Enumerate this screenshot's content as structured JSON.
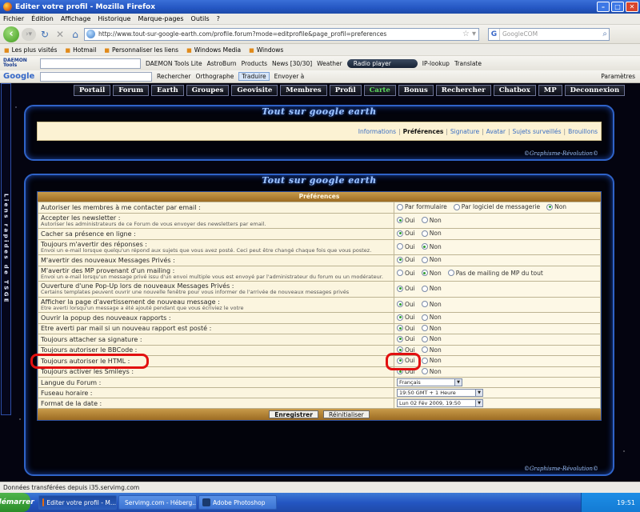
{
  "window": {
    "title": "Editer votre profil - Mozilla Firefox"
  },
  "menu": [
    "Fichier",
    "Édition",
    "Affichage",
    "Historique",
    "Marque-pages",
    "Outils",
    "?"
  ],
  "nav": {
    "url": "http://www.tout-sur-google-earth.com/profile.forum?mode=editprofile&page_profil=preferences",
    "search_placeholder": "GoogleCOM"
  },
  "bookmarks": [
    "Les plus visités",
    "Hotmail",
    "Personnaliser les liens",
    "Windows Media",
    "Windows"
  ],
  "daemon_toolbar": {
    "logo": "DAEMON Tools",
    "items": [
      "DAEMON Tools Lite",
      "AstroBurn",
      "Products",
      "News [30/30]",
      "Weather"
    ],
    "radio": "Radio player",
    "extras": [
      "IP-lookup",
      "Translate"
    ]
  },
  "google_toolbar": {
    "logo": "Google",
    "items": [
      "Rechercher",
      "Orthographe",
      "Traduire",
      "Envoyer à"
    ],
    "params": "Paramètres"
  },
  "forum_nav": [
    "Portail",
    "Forum",
    "Earth",
    "Groupes",
    "Geovisite",
    "Membres",
    "Profil",
    "Carte",
    "Bonus",
    "Rechercher",
    "Chatbox",
    "MP",
    "Deconnexion"
  ],
  "active_nav": "Carte",
  "quick_links": "Liens rapides de TSGE",
  "site_title": "Tout sur google earth",
  "credit": "©Graphisme-Révolution©",
  "profile_tabs": [
    "Informations",
    "Préférences",
    "Signature",
    "Avatar",
    "Sujets surveillés",
    "Brouillons"
  ],
  "prefs": {
    "header": "Préférences",
    "rows": [
      {
        "label": "Autoriser les membres à me contacter par email :",
        "desc": "",
        "options": [
          "Par formulaire",
          "Par logiciel de messagerie",
          "Non"
        ],
        "selected": 2
      },
      {
        "label": "Accepter les newsletter :",
        "desc": "Autoriser les administrateurs de ce Forum de vous envoyer des newsletters par email.",
        "options": [
          "Oui",
          "Non"
        ],
        "selected": 0
      },
      {
        "label": "Cacher sa présence en ligne :",
        "desc": "",
        "options": [
          "Oui",
          "Non"
        ],
        "selected": 0
      },
      {
        "label": "Toujours m'avertir des réponses :",
        "desc": "Envoi un e-mail lorsque quelqu'un répond aux sujets que vous avez posté. Ceci peut être changé chaque fois que vous postez.",
        "options": [
          "Oui",
          "Non"
        ],
        "selected": 1
      },
      {
        "label": "M'avertir des nouveaux Messages Privés :",
        "desc": "",
        "options": [
          "Oui",
          "Non"
        ],
        "selected": 0
      },
      {
        "label": "M'avertir des MP provenant d'un mailing :",
        "desc": "Envoi un e-mail lorsqu'un message privé issu d'un envoi multiple vous est envoyé par l'administrateur du forum ou un modérateur.",
        "options": [
          "Oui",
          "Non",
          "Pas de mailing de MP du tout"
        ],
        "selected": 1
      },
      {
        "label": "Ouverture d'une Pop-Up lors de nouveaux Messages Privés :",
        "desc": "Certains templates peuvent ouvrir une nouvelle fenêtre pour vous informer de l'arrivée de nouveaux messages privés",
        "options": [
          "Oui",
          "Non"
        ],
        "selected": 0
      },
      {
        "label": "Afficher la page d'avertissement de nouveau message :",
        "desc": "Etre averti lorsqu'un message a été ajouté pendant que vous écriviez le votre",
        "options": [
          "Oui",
          "Non"
        ],
        "selected": 0
      },
      {
        "label": "Ouvrir la popup des nouveaux rapports :",
        "desc": "",
        "options": [
          "Oui",
          "Non"
        ],
        "selected": 0
      },
      {
        "label": "Etre averti par mail si un nouveau rapport est posté :",
        "desc": "",
        "options": [
          "Oui",
          "Non"
        ],
        "selected": 0
      },
      {
        "label": "Toujours attacher sa signature :",
        "desc": "",
        "options": [
          "Oui",
          "Non"
        ],
        "selected": 0
      },
      {
        "label": "Toujours autoriser le BBCode :",
        "desc": "",
        "options": [
          "Oui",
          "Non"
        ],
        "selected": 0
      },
      {
        "label": "Toujours autoriser le HTML :",
        "desc": "",
        "options": [
          "Oui",
          "Non"
        ],
        "selected": 0
      },
      {
        "label": "Toujours activer les Smileys :",
        "desc": "",
        "options": [
          "Oui",
          "Non"
        ],
        "selected": 0
      },
      {
        "label": "Langue du Forum :",
        "desc": "",
        "select": "Français"
      },
      {
        "label": "Fuseau horaire :",
        "desc": "",
        "select": "19:50 GMT + 1 Heure"
      },
      {
        "label": "Format de la date :",
        "desc": "",
        "select": "Lun 02 Fév 2009, 19:50"
      }
    ],
    "submit": "Enregistrer",
    "reset": "Réinitialiser"
  },
  "status": "Données transférées depuis i35.servimg.com",
  "taskbar": {
    "start": "démarrer",
    "items": [
      "Editer votre profil - M...",
      "Servimg.com - Héberg...",
      "Adobe Photoshop"
    ],
    "clock": "19:51"
  }
}
